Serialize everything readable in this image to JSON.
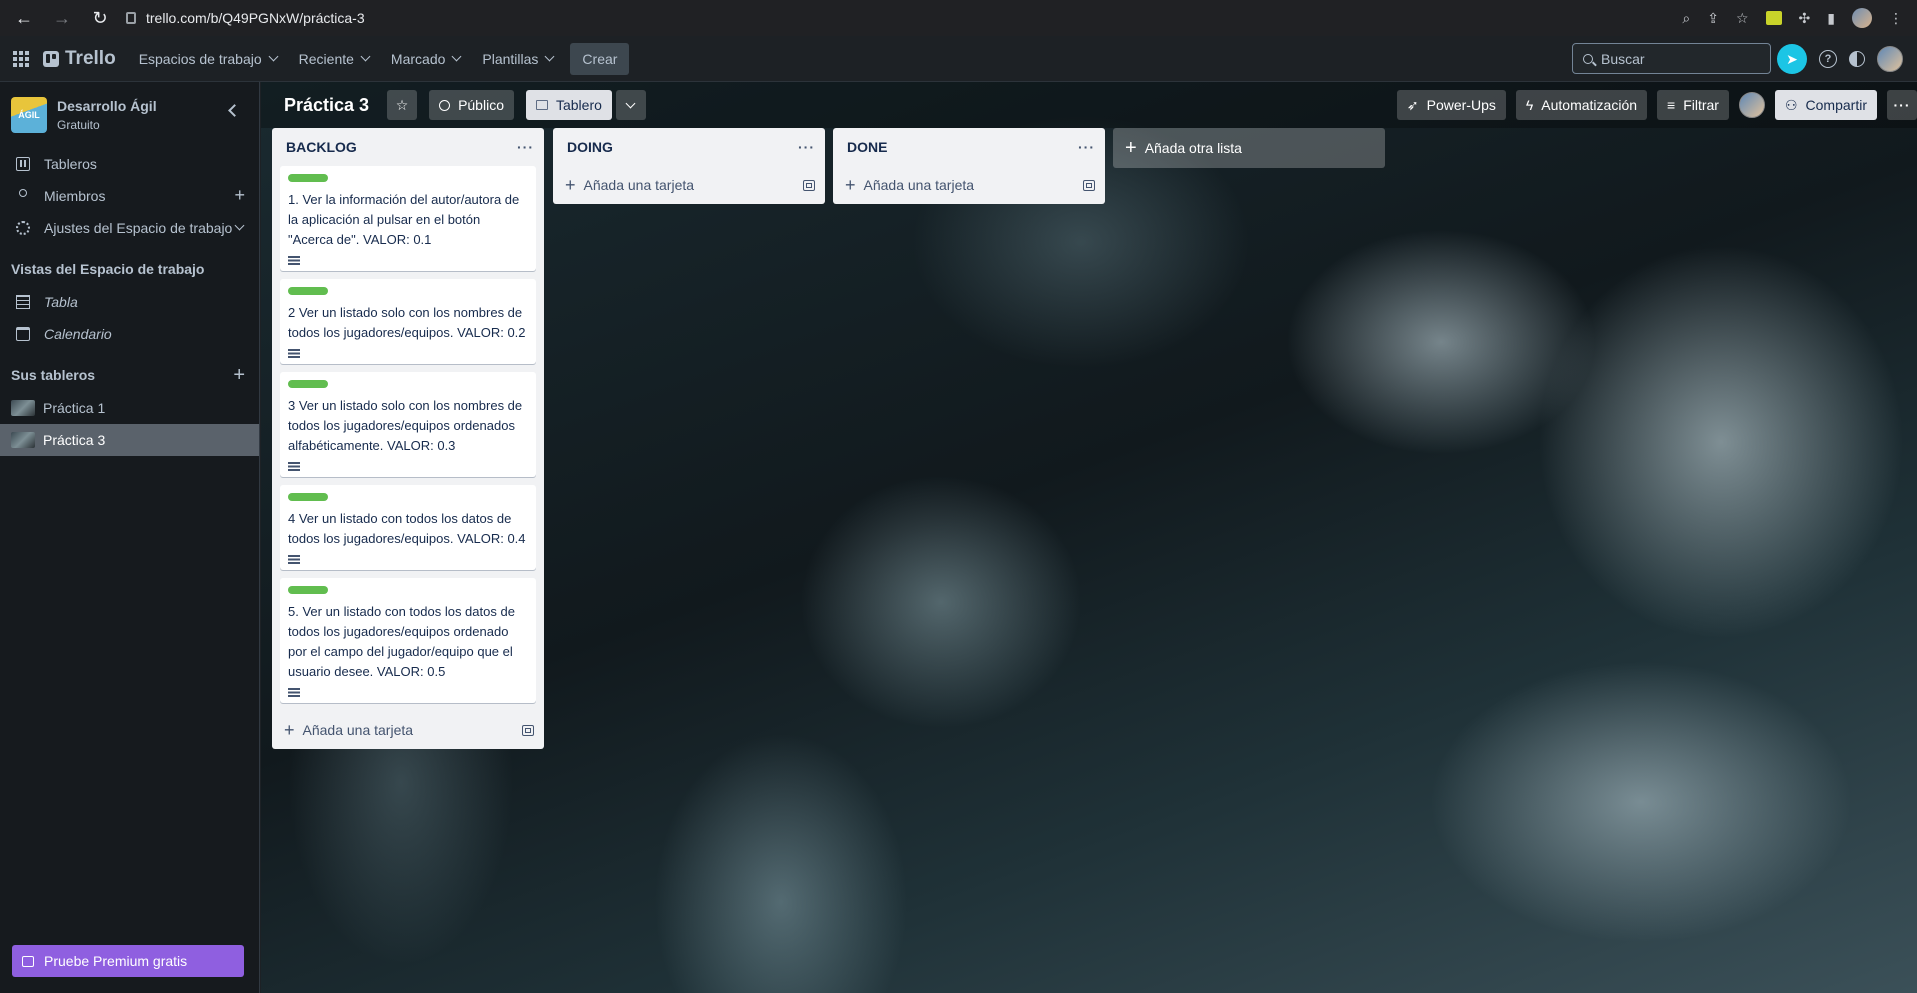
{
  "browser": {
    "url": "trello.com/b/Q49PGNxW/práctica-3"
  },
  "header": {
    "logo": "Trello",
    "menu": [
      {
        "label": "Espacios de trabajo"
      },
      {
        "label": "Reciente"
      },
      {
        "label": "Marcado"
      },
      {
        "label": "Plantillas"
      }
    ],
    "create_label": "Crear",
    "search_placeholder": "Buscar"
  },
  "sidebar": {
    "workspace_name": "Desarrollo Ágil",
    "workspace_plan": "Gratuito",
    "workspace_logo_text": "ÁGIL",
    "nav": [
      {
        "label": "Tableros"
      },
      {
        "label": "Miembros"
      },
      {
        "label": "Ajustes del Espacio de trabajo"
      }
    ],
    "views_title": "Vistas del Espacio de trabajo",
    "views": [
      {
        "label": "Tabla"
      },
      {
        "label": "Calendario"
      }
    ],
    "boards_title": "Sus tableros",
    "boards": [
      {
        "label": "Práctica 1"
      },
      {
        "label": "Práctica 3"
      }
    ],
    "premium_label": "Pruebe Premium gratis"
  },
  "board": {
    "title": "Práctica 3",
    "visibility": "Público",
    "view": "Tablero",
    "powerups": "Power-Ups",
    "automation": "Automatización",
    "filter": "Filtrar",
    "share": "Compartir",
    "add_list_label": "Añada otra lista",
    "lists": [
      {
        "title": "BACKLOG",
        "add_card_label": "Añada una tarjeta",
        "cards": [
          {
            "title": "1. Ver la información del autor/autora de la aplicación al pulsar en el botón \"Acerca de\". VALOR: 0.1"
          },
          {
            "title": "2 Ver un listado solo con los nombres de todos los jugadores/equipos. VALOR: 0.2"
          },
          {
            "title": "3 Ver un listado solo con los nombres de todos los jugadores/equipos ordenados alfabéticamente. VALOR: 0.3"
          },
          {
            "title": "4 Ver un listado con todos los datos de todos los jugadores/equipos. VALOR: 0.4"
          },
          {
            "title": "5. Ver un listado con todos los datos de todos los jugadores/equipos ordenado por el campo del jugador/equipo que el usuario desee. VALOR: 0.5"
          }
        ]
      },
      {
        "title": "DOING",
        "add_card_label": "Añada una tarjeta",
        "cards": []
      },
      {
        "title": "DONE",
        "add_card_label": "Añada una tarjeta",
        "cards": []
      }
    ]
  },
  "colors": {
    "label_green": "#61bd4f",
    "premium": "#8f5fe0",
    "notification": "#1cc5e5"
  }
}
